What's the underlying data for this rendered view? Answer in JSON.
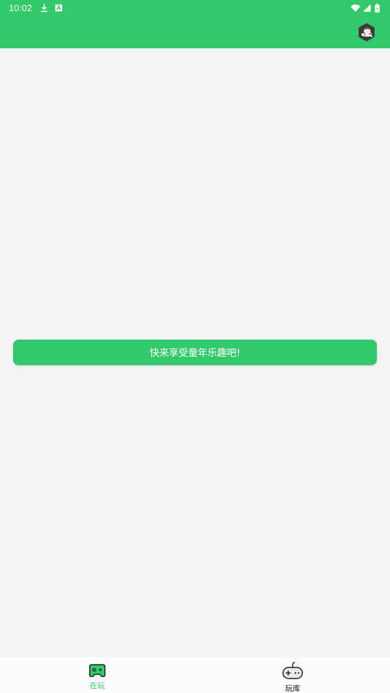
{
  "status_bar": {
    "time": "10:02",
    "left_icons": [
      "download-icon",
      "a-icon"
    ],
    "right_icons": [
      "wifi-icon",
      "signal-icon",
      "battery-icon"
    ]
  },
  "app_bar": {
    "actions": [
      "search-user-icon"
    ]
  },
  "main": {
    "cta_label": "快来享受童年乐趣吧!"
  },
  "bottom_nav": {
    "items": [
      {
        "label": "在玩",
        "icon": "gamepad-icon",
        "active": true
      },
      {
        "label": "玩库",
        "icon": "game-controller-icon",
        "active": false
      }
    ]
  },
  "colors": {
    "accent": "#33c96a",
    "background": "#f4f4f4",
    "active_label": "#33c96a",
    "inactive_label": "#111111"
  }
}
